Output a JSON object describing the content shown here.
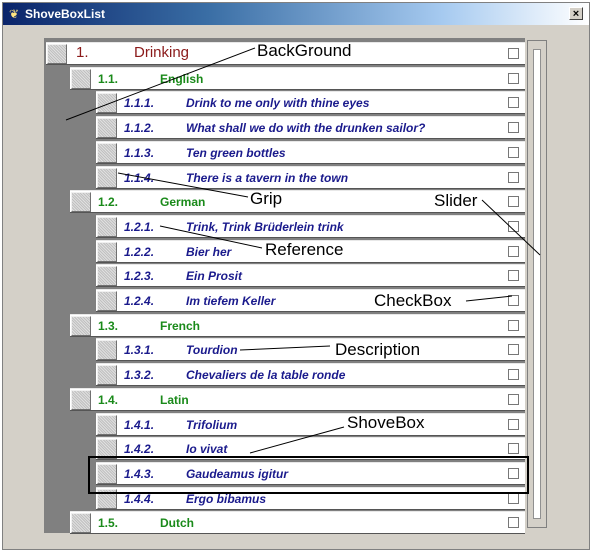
{
  "window": {
    "title": "ShoveBoxList",
    "close_label": "×"
  },
  "rows": [
    {
      "level": 0,
      "ref": "1.",
      "desc": "Drinking"
    },
    {
      "level": 1,
      "ref": "1.1.",
      "desc": "English"
    },
    {
      "level": 2,
      "ref": "1.1.1.",
      "desc": "Drink to me only with thine eyes"
    },
    {
      "level": 2,
      "ref": "1.1.2.",
      "desc": "What shall we do with the drunken sailor?"
    },
    {
      "level": 2,
      "ref": "1.1.3.",
      "desc": "Ten green bottles"
    },
    {
      "level": 2,
      "ref": "1.1.4.",
      "desc": "There is a tavern in the town"
    },
    {
      "level": 1,
      "ref": "1.2.",
      "desc": "German"
    },
    {
      "level": 2,
      "ref": "1.2.1.",
      "desc": "Trink, Trink Brüderlein trink"
    },
    {
      "level": 2,
      "ref": "1.2.2.",
      "desc": "Bier her"
    },
    {
      "level": 2,
      "ref": "1.2.3.",
      "desc": "Ein Prosit"
    },
    {
      "level": 2,
      "ref": "1.2.4.",
      "desc": "Im tiefem Keller"
    },
    {
      "level": 1,
      "ref": "1.3.",
      "desc": "French"
    },
    {
      "level": 2,
      "ref": "1.3.1.",
      "desc": "Tourdion"
    },
    {
      "level": 2,
      "ref": "1.3.2.",
      "desc": "Chevaliers de la table ronde"
    },
    {
      "level": 1,
      "ref": "1.4.",
      "desc": "Latin"
    },
    {
      "level": 2,
      "ref": "1.4.1.",
      "desc": "Trifolium"
    },
    {
      "level": 2,
      "ref": "1.4.2.",
      "desc": "Io vivat"
    },
    {
      "level": 2,
      "ref": "1.4.3.",
      "desc": "Gaudeamus igitur"
    },
    {
      "level": 2,
      "ref": "1.4.4.",
      "desc": "Ergo bibamus"
    },
    {
      "level": 1,
      "ref": "1.5.",
      "desc": "Dutch"
    }
  ],
  "annotations": {
    "background": "BackGround",
    "grip": "Grip",
    "slider": "Slider",
    "reference": "Reference",
    "checkbox": "CheckBox",
    "description": "Description",
    "shovebox": "ShoveBox"
  },
  "colors": {
    "level0": "#8b1a1a",
    "level1": "#1a8a1a",
    "level2": "#1a1a8c",
    "background": "#808080"
  }
}
